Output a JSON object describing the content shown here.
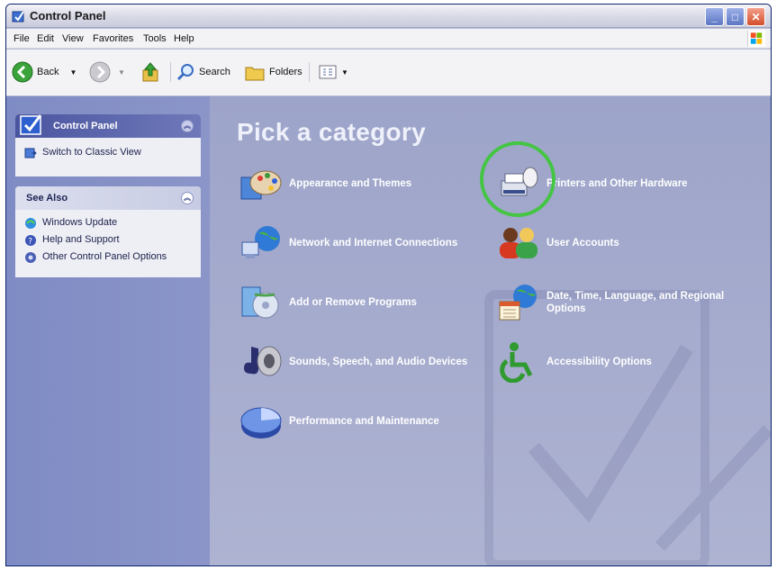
{
  "window": {
    "title": "Control Panel"
  },
  "menu": [
    "File",
    "Edit",
    "View",
    "Favorites",
    "Tools",
    "Help"
  ],
  "toolbar": {
    "back": "Back",
    "search": "Search",
    "folders": "Folders"
  },
  "sidebar": {
    "panel_title": "Control Panel",
    "switch_link": "Switch to Classic View",
    "see_also_title": "See Also",
    "see_also": [
      "Windows Update",
      "Help and Support",
      "Other Control Panel Options"
    ]
  },
  "main": {
    "heading": "Pick a category",
    "categories": [
      "Appearance and Themes",
      "Network and Internet Connections",
      "Add or Remove Programs",
      "Sounds, Speech, and Audio Devices",
      "Performance and Maintenance",
      "Printers and Other Hardware",
      "User Accounts",
      "Date, Time, Language, and Regional Options",
      "Accessibility Options"
    ],
    "highlighted_category": "Printers and Other Hardware"
  },
  "colors": {
    "accent_highlight": "#44c543",
    "main_bg": "#9da4c9",
    "sidebar_bg": "#7f8bc4"
  }
}
